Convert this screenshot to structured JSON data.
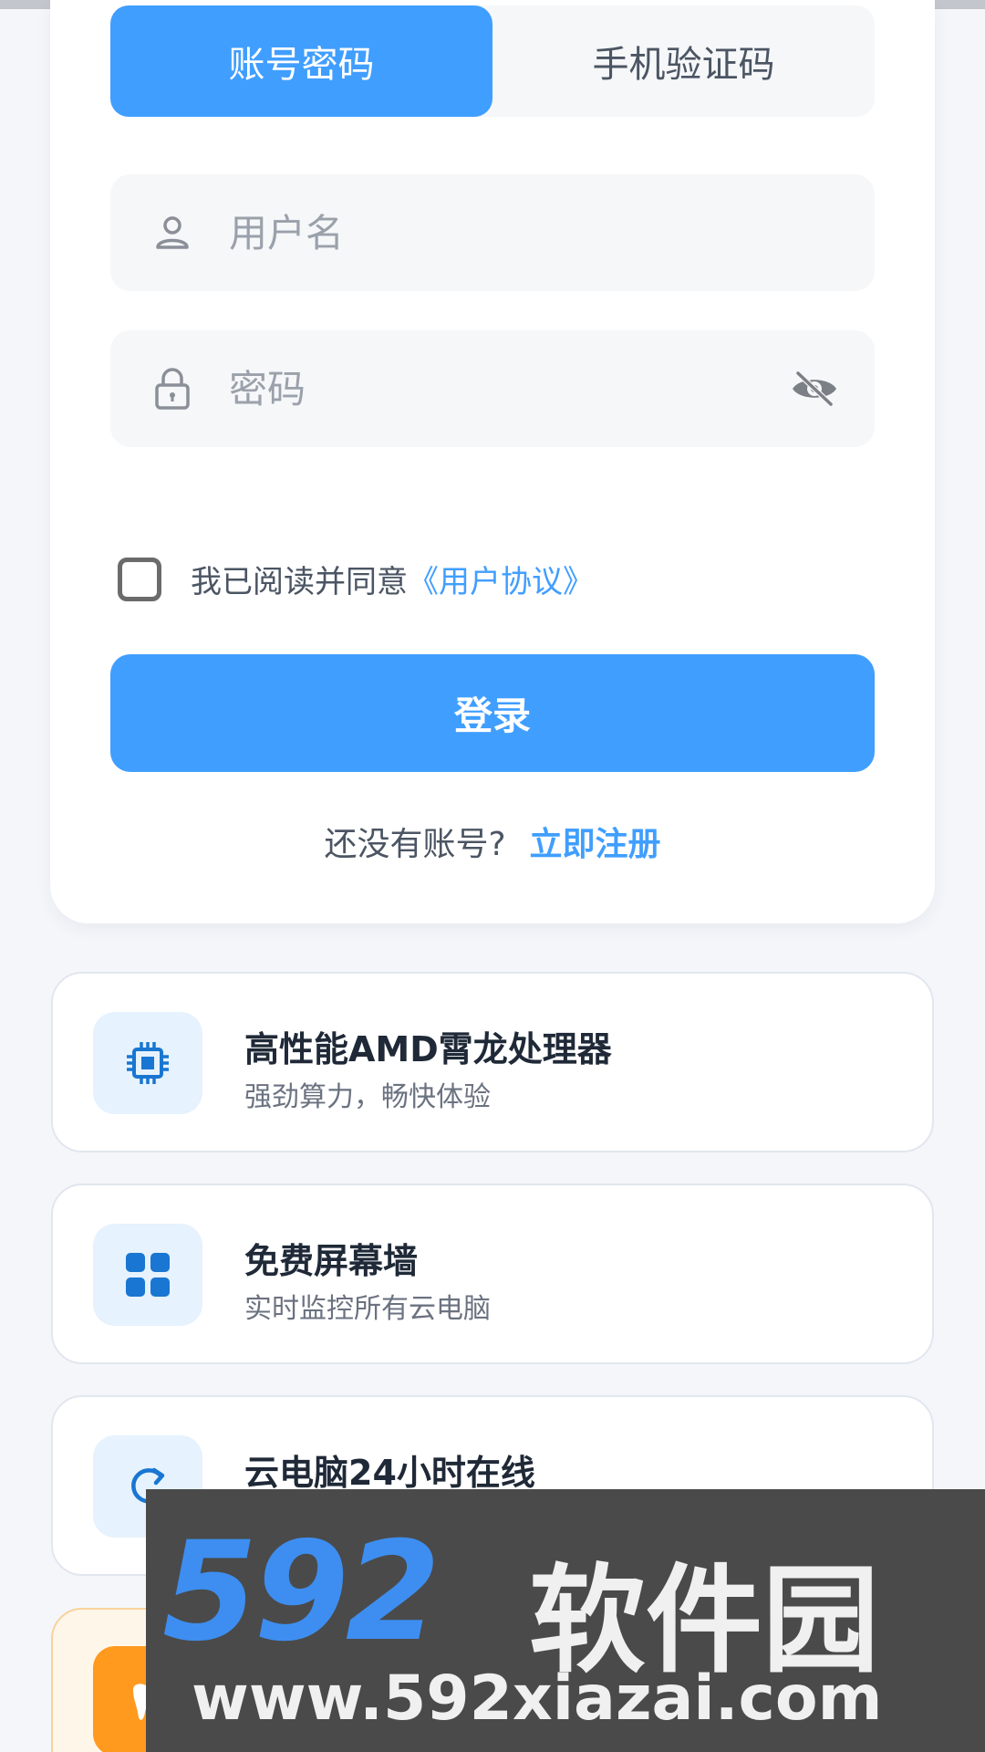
{
  "tabs": [
    {
      "label": "账号密码",
      "active": true
    },
    {
      "label": "手机验证码",
      "active": false
    }
  ],
  "form": {
    "username_placeholder": "用户名",
    "password_placeholder": "密码"
  },
  "agreement": {
    "text": "我已阅读并同意",
    "link": "《用户协议》",
    "checked": false
  },
  "login_button": "登录",
  "register": {
    "question": "还没有账号?",
    "link": "立即注册"
  },
  "features": [
    {
      "title": "高性能AMD霄龙处理器",
      "subtitle": "强劲算力，畅快体验",
      "icon": "cpu-icon"
    },
    {
      "title": "免费屏幕墙",
      "subtitle": "实时监控所有云电脑",
      "icon": "grid-icon"
    },
    {
      "title": "云电脑24小时在线",
      "subtitle": "",
      "icon": "refresh-icon"
    }
  ],
  "watermark": {
    "brand_number": "592",
    "brand_name": "软件园",
    "url": "www.592xiazai.com"
  },
  "colors": {
    "primary": "#409eff",
    "orange_accent": "#ff9a1f"
  }
}
